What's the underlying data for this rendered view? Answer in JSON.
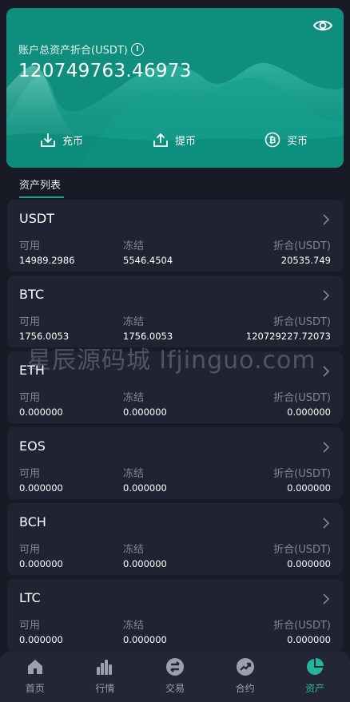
{
  "hero": {
    "label": "账户总资产折合(USDT)",
    "info_icon": "!",
    "total": "120749763.46973",
    "actions": [
      {
        "label": "充币",
        "icon": "deposit-icon"
      },
      {
        "label": "提币",
        "icon": "withdraw-icon"
      },
      {
        "label": "买币",
        "icon": "bitcoin-icon"
      }
    ]
  },
  "list_tab": "资产列表",
  "columns": {
    "available": "可用",
    "frozen": "冻结",
    "converted": "折合(USDT)"
  },
  "assets": [
    {
      "name": "USDT",
      "available": "14989.2986",
      "frozen": "5546.4504",
      "converted": "20535.749"
    },
    {
      "name": "BTC",
      "available": "1756.0053",
      "frozen": "1756.0053",
      "converted": "120729227.72073"
    },
    {
      "name": "ETH",
      "available": "0.000000",
      "frozen": "0.000000",
      "converted": "0.000000"
    },
    {
      "name": "EOS",
      "available": "0.000000",
      "frozen": "0.000000",
      "converted": "0.000000"
    },
    {
      "name": "BCH",
      "available": "0.000000",
      "frozen": "0.000000",
      "converted": "0.000000"
    },
    {
      "name": "LTC",
      "available": "0.000000",
      "frozen": "0.000000",
      "converted": "0.000000"
    }
  ],
  "watermark": "星辰源码城 lfjinguo.com",
  "nav": [
    {
      "label": "首页",
      "icon": "home-icon"
    },
    {
      "label": "行情",
      "icon": "bar-chart-icon"
    },
    {
      "label": "交易",
      "icon": "exchange-icon"
    },
    {
      "label": "合约",
      "icon": "trend-up-icon"
    },
    {
      "label": "资产",
      "icon": "pie-chart-icon",
      "active": true
    }
  ],
  "colors": {
    "accent": "#23b69e",
    "hero": "#139483",
    "card": "#202331",
    "background": "#181a25"
  }
}
